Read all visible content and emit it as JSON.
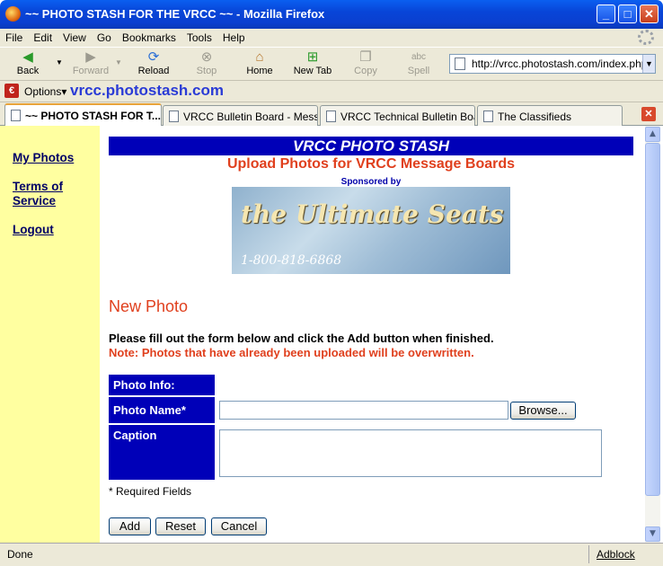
{
  "window": {
    "title": "~~ PHOTO STASH FOR THE VRCC ~~ - Mozilla Firefox"
  },
  "menu": [
    "File",
    "Edit",
    "View",
    "Go",
    "Bookmarks",
    "Tools",
    "Help"
  ],
  "toolbar": {
    "back": "Back",
    "forward": "Forward",
    "reload": "Reload",
    "stop": "Stop",
    "home": "Home",
    "new_tab": "New Tab",
    "copy": "Copy",
    "spell": "Spell",
    "url": "http://vrcc.photostash.com/index.php"
  },
  "options_bar": {
    "options": "Options",
    "site": "vrcc.photostash.com"
  },
  "tabs": [
    {
      "label": "~~ PHOTO STASH FOR T...",
      "active": true
    },
    {
      "label": "VRCC Bulletin Board - Messa...",
      "active": false
    },
    {
      "label": "VRCC Technical Bulletin Boa...",
      "active": false
    },
    {
      "label": "The Classifieds",
      "active": false
    }
  ],
  "sidebar": {
    "my_photos": "My Photos",
    "terms_line1": "Terms of",
    "terms_line2": "Service",
    "logout": "Logout"
  },
  "page": {
    "banner": "VRCC PHOTO STASH",
    "subtitle": "Upload Photos for VRCC Message Boards",
    "sponsored": "Sponsored by",
    "ad_brand": "the Ultimate Seats",
    "ad_phone": "1-800-818-6868",
    "heading": "New Photo",
    "instructions": "Please fill out the form below and click the Add button when finished.",
    "note": "Note: Photos that have already been uploaded will be overwritten."
  },
  "form": {
    "info_label": "Photo Info:",
    "name_label": "Photo Name*",
    "name_value": "",
    "browse": "Browse...",
    "caption_label": "Caption",
    "caption_value": "",
    "required_note": "* Required Fields",
    "add": "Add",
    "reset": "Reset",
    "cancel": "Cancel"
  },
  "status": {
    "text": "Done",
    "adblock": "Adblock"
  },
  "colors": {
    "banner_blue": "#0000b8",
    "accent_red": "#e0401e",
    "sidebar_yellow": "#ffffa0"
  }
}
